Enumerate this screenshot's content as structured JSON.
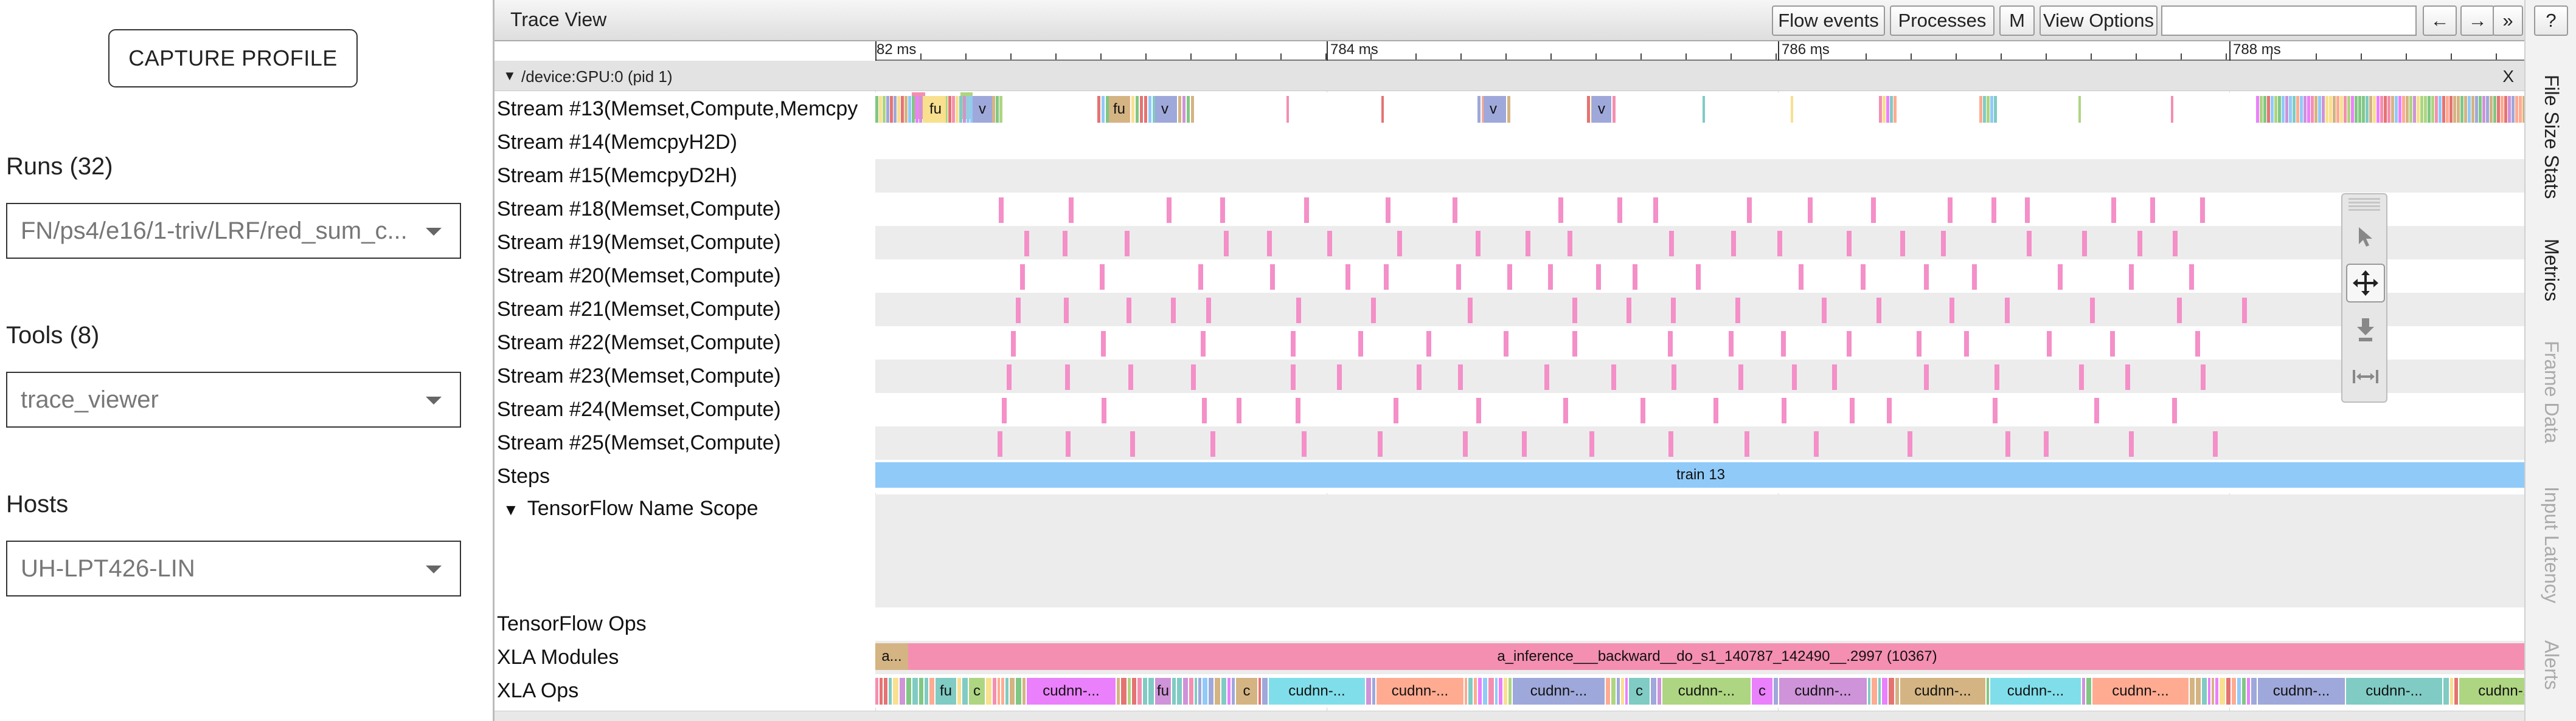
{
  "left_panel": {
    "capture_button": "CAPTURE PROFILE",
    "runs_label": "Runs (32)",
    "runs_value": "FN/ps4/e16/1-triv/LRF/red_sum_c...",
    "tools_label": "Tools (8)",
    "tools_value": "trace_viewer",
    "hosts_label": "Hosts",
    "hosts_value": "UH-LPT426-LIN"
  },
  "trace": {
    "title": "Trace View",
    "buttons": {
      "flow_events": "Flow events",
      "processes": "Processes",
      "m": "M",
      "view_options": "View Options",
      "prev": "←",
      "next": "→",
      "more": "»",
      "help": "?"
    },
    "ruler_ticks": [
      "82 ms",
      "784 ms",
      "786 ms",
      "788 ms"
    ],
    "process": {
      "label": "/device:GPU:0 (pid 1)",
      "close": "X"
    },
    "tracks": {
      "stream13": "Stream #13(Memset,Compute,Memcpy",
      "stream14": "Stream #14(MemcpyH2D)",
      "stream15": "Stream #15(MemcpyD2H)",
      "stream18": "Stream #18(Memset,Compute)",
      "stream19": "Stream #19(Memset,Compute)",
      "stream20": "Stream #20(Memset,Compute)",
      "stream21": "Stream #21(Memset,Compute)",
      "stream22": "Stream #22(Memset,Compute)",
      "stream23": "Stream #23(Memset,Compute)",
      "stream24": "Stream #24(Memset,Compute)",
      "stream25": "Stream #25(Memset,Compute)",
      "steps": "Steps",
      "tf_name_scope": "TensorFlow Name Scope",
      "tf_ops": "TensorFlow Ops",
      "xla_modules": "XLA Modules",
      "xla_ops": "XLA Ops"
    },
    "stream13_labels": [
      "fu",
      "v",
      "fu",
      "v",
      "v",
      "v"
    ],
    "steps_slice": "train 13",
    "xla_modules": {
      "small": "a...",
      "main": "a_inference___backward__do_s1_140787_142490__.2997 (10367)"
    },
    "xla_ops_labels": [
      "fu",
      "c",
      "cudnn-...",
      "fu",
      "c",
      "cudnn-...",
      "cudnn-...",
      "cudnn-...",
      "c",
      "cudnn-...",
      "c",
      "cudnn-...",
      "cudnn-...",
      "cudnn-...",
      "cudnn-...",
      "cudnn-...",
      "cudnn-...",
      "cudnn-..."
    ]
  },
  "palette": {
    "tools": [
      "select-icon",
      "pan-icon",
      "zoom-icon",
      "timing-icon"
    ],
    "active": "pan-icon"
  },
  "side_tabs": [
    "File Size Stats",
    "Metrics",
    "Frame Data",
    "Input Latency",
    "Alerts"
  ],
  "colors": {
    "pink_event": "#f48fc8",
    "steps_blue": "#90caf9",
    "xla_module_pink": "#f48fb1",
    "xla_module_tan": "#d4b483"
  }
}
